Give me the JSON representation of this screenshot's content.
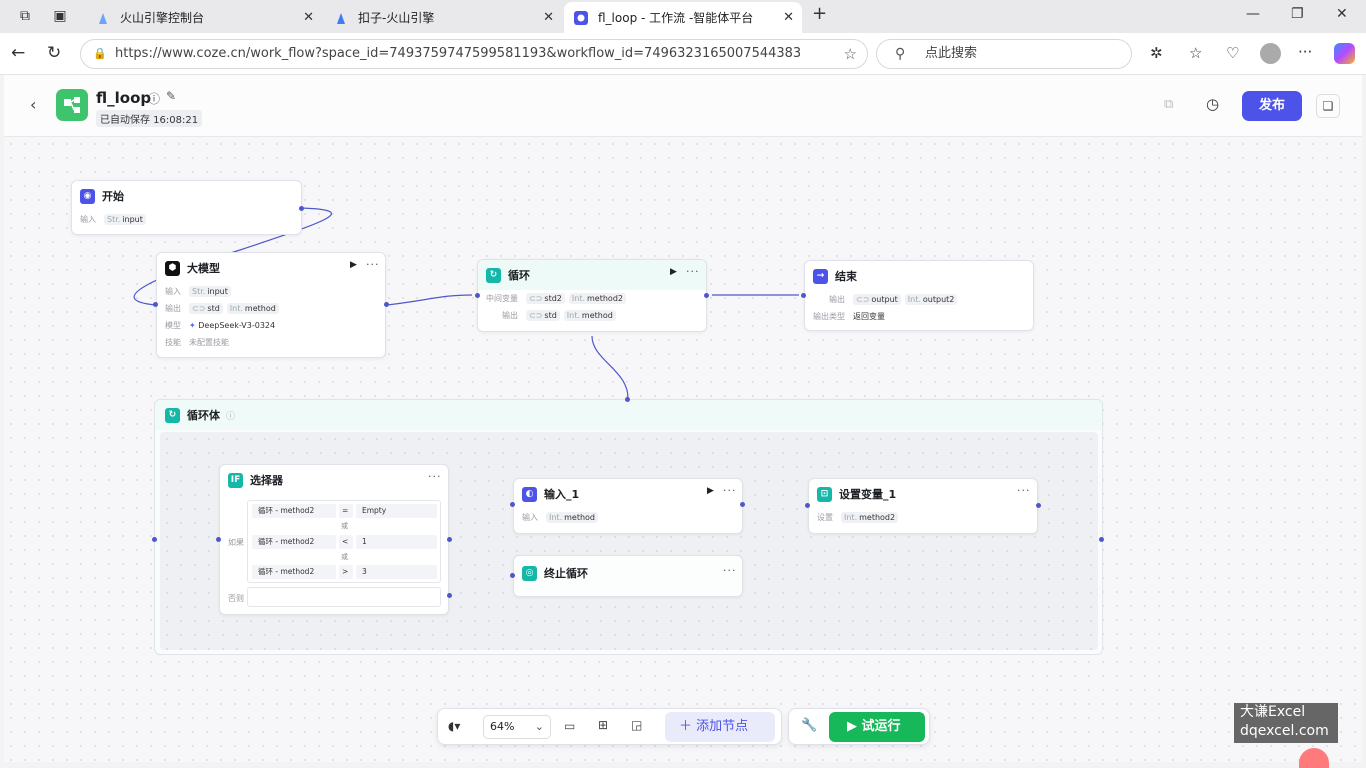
{
  "browser": {
    "tabs": [
      {
        "title": "火山引擎控制台"
      },
      {
        "title": "扣子-火山引擎"
      },
      {
        "title": "fl_loop - 工作流 -智能体平台"
      }
    ],
    "url": "https://www.coze.cn/work_flow?space_id=7493759747599581193&workflow_id=7496323165007544383",
    "search_placeholder": "点此搜索"
  },
  "app": {
    "title": "fl_loop",
    "autosave": "已自动保存 16:08:21",
    "publish_label": "发布"
  },
  "nodes": {
    "start": {
      "title": "开始",
      "input_label": "输入",
      "input_type": "Str.",
      "input_name": "input"
    },
    "llm": {
      "title": "大模型",
      "input_label": "输入",
      "input_type": "Str.",
      "input_name": "input",
      "output_label": "输出",
      "out1": "std",
      "out2_type": "Int.",
      "out2": "method",
      "model_label": "模型",
      "model": "DeepSeek-V3-0324",
      "skill_label": "技能",
      "skill": "未配置技能"
    },
    "loop": {
      "title": "循环",
      "mid_label": "中间变量",
      "mid1": "std2",
      "mid2_type": "Int.",
      "mid2": "method2",
      "out_label": "输出",
      "out1": "std",
      "out2_type": "Int.",
      "out2": "method"
    },
    "end": {
      "title": "结束",
      "out_label": "输出",
      "out1": "output",
      "out2_type": "Int.",
      "out2": "output2",
      "type_label": "输出类型",
      "type": "返回变量"
    },
    "loop_body": {
      "title": "循环体"
    },
    "selector": {
      "title": "选择器",
      "if_label": "如果",
      "else_label": "否则",
      "or_label": "或",
      "conditions": [
        {
          "left": "循环 - method2",
          "op": "=",
          "right": "Empty"
        },
        {
          "left": "循环 - method2",
          "op": "<",
          "right": "1"
        },
        {
          "left": "循环 - method2",
          "op": ">",
          "right": "3"
        }
      ]
    },
    "input1": {
      "title": "输入_1",
      "label": "输入",
      "type": "Int.",
      "name": "method"
    },
    "setvar": {
      "title": "设置变量_1",
      "label": "设置",
      "type": "Int.",
      "name": "method2"
    },
    "break": {
      "title": "终止循环"
    }
  },
  "toolbar": {
    "zoom": "64%",
    "add_node_label": "添加节点",
    "test_run_label": "试运行"
  },
  "watermark": {
    "line1": "大谦Excel",
    "line2": "dqexcel.com"
  },
  "colors": {
    "accent": "#4d53e8",
    "green": "#16b85a",
    "loop_teal": "#15b7a8",
    "edge": "#4f58c9"
  }
}
